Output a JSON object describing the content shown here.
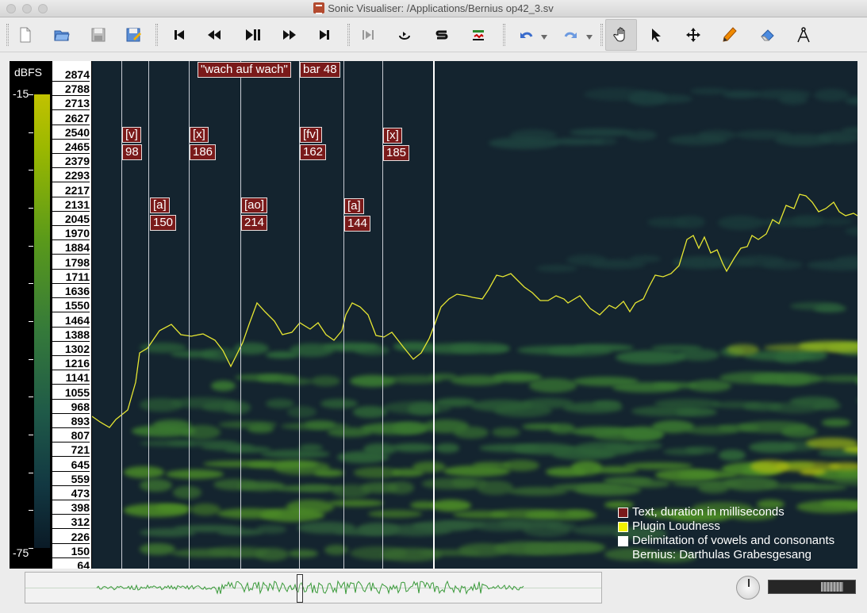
{
  "window": {
    "title": "Sonic Visualiser: /Applications/Bernius op42_3.sv"
  },
  "toolbar": {
    "buttons": [
      {
        "name": "new-session",
        "icon": "document-icon"
      },
      {
        "name": "open",
        "icon": "folder-open-icon"
      },
      {
        "name": "save",
        "icon": "save-icon"
      },
      {
        "name": "save-as",
        "icon": "save-as-icon"
      },
      {
        "name": "rewind-start",
        "icon": "skip-start-icon"
      },
      {
        "name": "rewind",
        "icon": "rewind-icon"
      },
      {
        "name": "play-pause",
        "icon": "play-pause-icon"
      },
      {
        "name": "fast-forward",
        "icon": "fast-forward-icon"
      },
      {
        "name": "ffwd-end",
        "icon": "skip-end-icon"
      },
      {
        "name": "play-selection",
        "icon": "play-selection-icon"
      },
      {
        "name": "loop",
        "icon": "loop-icon"
      },
      {
        "name": "solo",
        "icon": "solo-icon"
      },
      {
        "name": "align",
        "icon": "align-icon"
      },
      {
        "name": "undo",
        "icon": "undo-icon"
      },
      {
        "name": "redo",
        "icon": "redo-icon"
      },
      {
        "name": "navigate",
        "icon": "hand-icon"
      },
      {
        "name": "select",
        "icon": "arrow-pointer-icon"
      },
      {
        "name": "edit",
        "icon": "move-icon"
      },
      {
        "name": "draw",
        "icon": "pencil-icon"
      },
      {
        "name": "erase",
        "icon": "eraser-icon"
      },
      {
        "name": "measure",
        "icon": "compass-icon"
      }
    ]
  },
  "colorbar": {
    "unit": "dBFS",
    "top": "-15",
    "bottom": "-75"
  },
  "scale": {
    "labels": [
      "2874",
      "2788",
      "2713",
      "2627",
      "2540",
      "2465",
      "2379",
      "2293",
      "2217",
      "2131",
      "2045",
      "1970",
      "1884",
      "1798",
      "1711",
      "1636",
      "1550",
      "1464",
      "1388",
      "1302",
      "1216",
      "1141",
      "1055",
      "968",
      "893",
      "807",
      "721",
      "645",
      "559",
      "473",
      "398",
      "312",
      "226",
      "150",
      "64"
    ]
  },
  "annotations": {
    "header_text": "\"wach auf wach\"",
    "header_bar": "bar 48",
    "items": [
      {
        "text": "[v]",
        "duration": "98"
      },
      {
        "text": "[a]",
        "duration": "150"
      },
      {
        "text": "[x]",
        "duration": "186"
      },
      {
        "text": "[ao]",
        "duration": "214"
      },
      {
        "text": "[fv]",
        "duration": "162"
      },
      {
        "text": "[a]",
        "duration": "144"
      },
      {
        "text": "[x]",
        "duration": "185"
      }
    ]
  },
  "legend": {
    "items": [
      {
        "label": "Text, duration in milliseconds",
        "color": "#7a1a1a"
      },
      {
        "label": "Plugin Loudness",
        "color": "#f0f000"
      },
      {
        "label": "Delimitation of vowels and consonants",
        "color": "#ffffff"
      }
    ],
    "caption": "Bernius: Darthulas Grabesgesang"
  },
  "colors": {
    "spectrogram_bg": "#14242f",
    "loudness_line": "#e6e632",
    "annotation_box": "#7a1a1a"
  }
}
